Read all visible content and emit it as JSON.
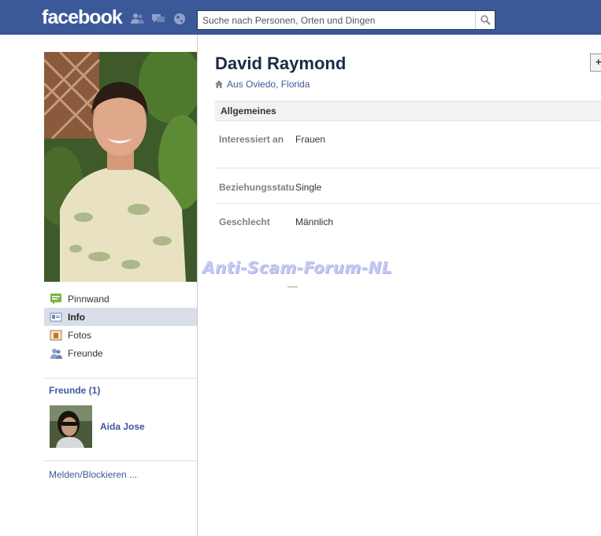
{
  "header": {
    "logo": "facebook",
    "search": {
      "placeholder": "Suche nach Personen, Orten und Dingen"
    },
    "jewels": [
      "friends-requests-icon",
      "messages-icon",
      "notifications-globe-icon"
    ]
  },
  "profile": {
    "name": "David Raymond",
    "location_prefix": "Aus ",
    "city": "Oviedo",
    "separator": ", ",
    "state": "Florida",
    "edge_button": "+"
  },
  "nav": {
    "items": [
      {
        "label": "Pinnwand",
        "icon": "wall-icon",
        "active": false
      },
      {
        "label": "Info",
        "icon": "info-icon",
        "active": true
      },
      {
        "label": "Fotos",
        "icon": "photos-icon",
        "active": false
      },
      {
        "label": "Freunde",
        "icon": "friends-icon",
        "active": false
      }
    ]
  },
  "friends": {
    "title": "Freunde (1)",
    "list": [
      {
        "name": "Aida Jose"
      }
    ]
  },
  "report_link": "Melden/Blockieren ...",
  "info": {
    "section_title": "Allgemeines",
    "rows": [
      {
        "label": "Interessiert an",
        "value": "Frauen"
      },
      {
        "label": "Beziehungsstatus",
        "value": "Single"
      },
      {
        "label": "Geschlecht",
        "value": "Männlich"
      }
    ]
  },
  "watermark": "Anti-Scam-Forum-NL",
  "colors": {
    "brand": "#3b5998",
    "active_nav": "#d8dfea",
    "section_bg": "#f2f2f2"
  }
}
